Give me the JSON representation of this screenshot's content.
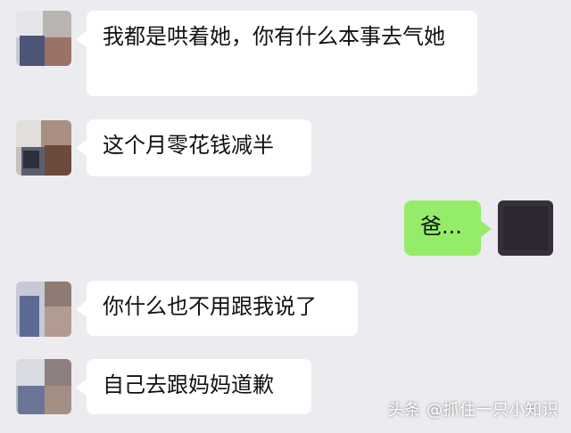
{
  "messages": [
    {
      "side": "left",
      "text": "我都是哄着她，你有什么本事去气她"
    },
    {
      "side": "left",
      "text": "这个月零花钱减半"
    },
    {
      "side": "right",
      "text": "爸..."
    },
    {
      "side": "left",
      "text": "你什么也不用跟我说了"
    },
    {
      "side": "left",
      "text": "自己去跟妈妈道歉"
    }
  ],
  "avatars": {
    "contact": "blurred-contact-avatar",
    "self": "dark-self-avatar"
  },
  "watermark": "头条 @抓住一只小知识",
  "colors": {
    "background": "#ececf0",
    "incoming_bubble": "#ffffff",
    "outgoing_bubble": "#95ec69"
  }
}
